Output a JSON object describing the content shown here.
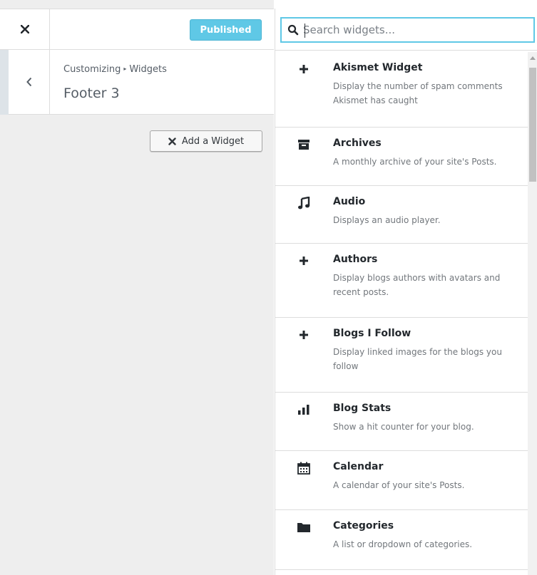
{
  "header": {
    "published_label": "Published"
  },
  "section": {
    "crumb_root": "Customizing",
    "crumb_child": "Widgets",
    "title": "Footer 3"
  },
  "add_widget": {
    "label": "Add a Widget"
  },
  "search": {
    "placeholder": "Search widgets..."
  },
  "colors": {
    "accent": "#5fc8e6",
    "panel_bg": "#eeeeee",
    "desc_text": "#72777c"
  },
  "widgets": [
    {
      "icon": "plus-icon",
      "title": "Akismet Widget",
      "desc": "Display the number of spam comments Akismet has caught"
    },
    {
      "icon": "archive-icon",
      "title": "Archives",
      "desc": "A monthly archive of your site's Posts."
    },
    {
      "icon": "music-icon",
      "title": "Audio",
      "desc": "Displays an audio player."
    },
    {
      "icon": "plus-icon",
      "title": "Authors",
      "desc": "Display blogs authors with avatars and recent posts."
    },
    {
      "icon": "plus-icon",
      "title": "Blogs I Follow",
      "desc": "Display linked images for the blogs you follow"
    },
    {
      "icon": "chart-bar-icon",
      "title": "Blog Stats",
      "desc": "Show a hit counter for your blog."
    },
    {
      "icon": "calendar-icon",
      "title": "Calendar",
      "desc": "A calendar of your site's Posts."
    },
    {
      "icon": "folder-icon",
      "title": "Categories",
      "desc": "A list or dropdown of categories."
    }
  ]
}
